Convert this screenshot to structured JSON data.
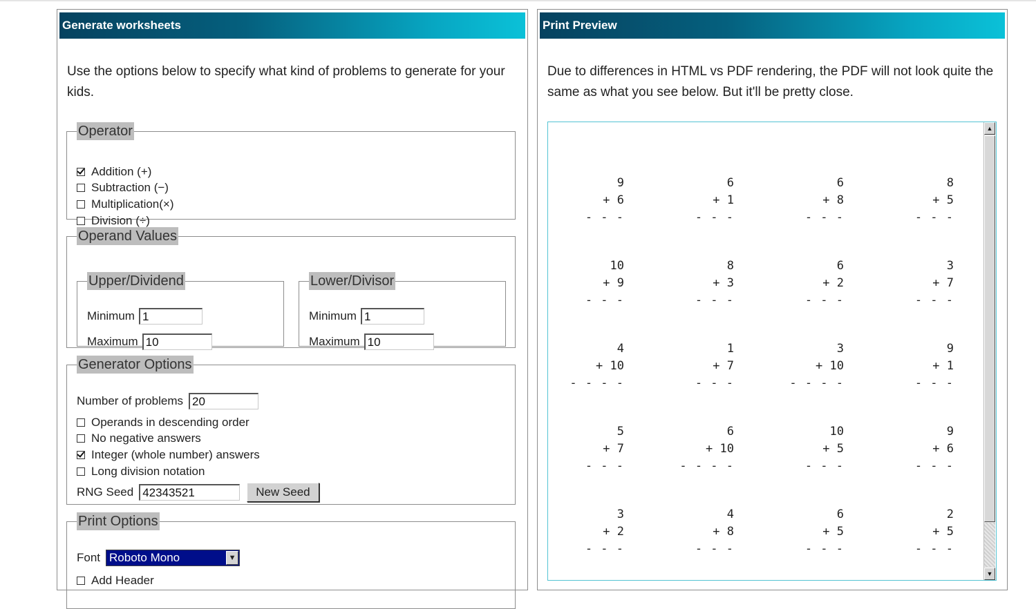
{
  "left_panel": {
    "title": "Generate worksheets",
    "intro": "Use the options below to specify what kind of problems to generate for your kids.",
    "operator": {
      "legend": "Operator",
      "options": [
        {
          "label": "Addition (+)",
          "checked": true
        },
        {
          "label": "Subtraction (−)",
          "checked": false
        },
        {
          "label": "Multiplication(×)",
          "checked": false
        },
        {
          "label": "Division (÷)",
          "checked": false
        }
      ]
    },
    "operand_values": {
      "legend": "Operand Values",
      "upper": {
        "legend": "Upper/Dividend",
        "min_label": "Minimum",
        "min_value": "1",
        "max_label": "Maximum",
        "max_value": "10"
      },
      "lower": {
        "legend": "Lower/Divisor",
        "min_label": "Minimum",
        "min_value": "1",
        "max_label": "Maximum",
        "max_value": "10"
      }
    },
    "generator_options": {
      "legend": "Generator Options",
      "num_problems_label": "Number of problems",
      "num_problems_value": "20",
      "checkboxes": [
        {
          "label": "Operands in descending order",
          "checked": false
        },
        {
          "label": "No negative answers",
          "checked": false
        },
        {
          "label": "Integer (whole number) answers",
          "checked": true
        },
        {
          "label": "Long division notation",
          "checked": false
        }
      ],
      "rng_label": "RNG Seed",
      "rng_value": "42343521",
      "new_seed_label": "New Seed"
    },
    "print_options": {
      "legend": "Print Options",
      "font_label": "Font",
      "font_value": "Roboto Mono",
      "add_header_label": "Add Header",
      "add_header_checked": false
    }
  },
  "right_panel": {
    "title": "Print Preview",
    "intro": "Due to differences in HTML vs PDF rendering, the PDF will not look quite the same as what you see below. But it'll be pretty close.",
    "problems": [
      {
        "top": "9",
        "bottom": "+ 6",
        "line": "- - -"
      },
      {
        "top": "6",
        "bottom": "+ 1",
        "line": "- - -"
      },
      {
        "top": "6",
        "bottom": "+ 8",
        "line": "- - -"
      },
      {
        "top": "8",
        "bottom": "+ 5",
        "line": "- - -"
      },
      {
        "top": "10",
        "bottom": "+ 9",
        "line": "- - -"
      },
      {
        "top": "8",
        "bottom": "+ 3",
        "line": "- - -"
      },
      {
        "top": "6",
        "bottom": "+ 2",
        "line": "- - -"
      },
      {
        "top": "3",
        "bottom": "+ 7",
        "line": "- - -"
      },
      {
        "top": "4",
        "bottom": "+ 10",
        "line": "- - - -"
      },
      {
        "top": "1",
        "bottom": "+ 7",
        "line": "- - -"
      },
      {
        "top": "3",
        "bottom": "+ 10",
        "line": "- - - -"
      },
      {
        "top": "9",
        "bottom": "+ 1",
        "line": "- - -"
      },
      {
        "top": "5",
        "bottom": "+ 7",
        "line": "- - -"
      },
      {
        "top": "6",
        "bottom": "+ 10",
        "line": "- - - -"
      },
      {
        "top": "10",
        "bottom": "+ 5",
        "line": "- - -"
      },
      {
        "top": "9",
        "bottom": "+ 6",
        "line": "- - -"
      },
      {
        "top": "3",
        "bottom": "+ 2",
        "line": "- - -"
      },
      {
        "top": "4",
        "bottom": "+ 8",
        "line": "- - -"
      },
      {
        "top": "6",
        "bottom": "+ 5",
        "line": "- - -"
      },
      {
        "top": "2",
        "bottom": "+ 5",
        "line": "- - -"
      }
    ]
  }
}
